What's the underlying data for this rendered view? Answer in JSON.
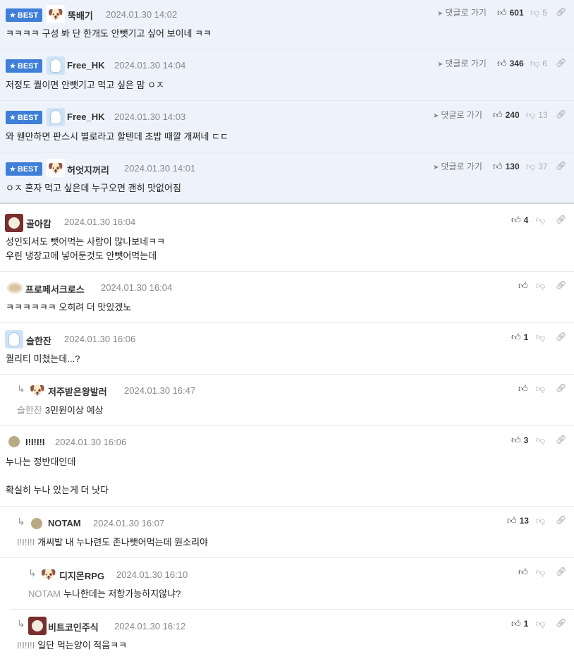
{
  "best_label": "BEST",
  "goto_label": "댓글로 가기",
  "comments": [
    {
      "nick": "뚝배기",
      "date": "2024.01.30 14:02",
      "up": "601",
      "down": "5",
      "text": "ㅋㅋㅋㅋ 구성 봐 단 한개도 안뺏기고 싶어 보이네 ㅋㅋ"
    },
    {
      "nick": "Free_HK",
      "date": "2024.01.30 14:04",
      "up": "346",
      "down": "6",
      "text": "저정도 퀄이면 안뺏기고 먹고 싶은 맘 ㅇㅈ"
    },
    {
      "nick": "Free_HK",
      "date": "2024.01.30 14:03",
      "up": "240",
      "down": "13",
      "text": "와 웬만하면 판스시 별로라고 할텐데 초밥 때깔 개쩌네 ㄷㄷ"
    },
    {
      "nick": "허엇지꺼리",
      "date": "2024.01.30 14:01",
      "up": "130",
      "down": "37",
      "text": "ㅇㅈ 혼자 먹고 싶은데 누구오면 괜히 맛없어짐"
    },
    {
      "nick": "골아캄",
      "date": "2024.01.30 16:04",
      "up": "4",
      "down": "",
      "text": "성인되서도 뺏어먹는 사람이 많나보네ㅋㅋ\n우린 냉장고에 넣어둔것도 안뺏어먹는데"
    },
    {
      "nick": "프로페서크로스",
      "date": "2024.01.30 16:04",
      "up": "",
      "down": "",
      "text": "ㅋㅋㅋㅋㅋㅋ 오히려 더 맛있겠노"
    },
    {
      "nick": "슬한잔",
      "date": "2024.01.30 16:06",
      "up": "1",
      "down": "",
      "text": "퀄리티 미쳤는데...?"
    },
    {
      "nick": "저주받은왕발러",
      "date": "2024.01.30 16:47",
      "up": "",
      "down": "",
      "mention": "슬한잔",
      "text": "3민원이상 예상"
    },
    {
      "nick": "I!I!I!I",
      "date": "2024.01.30 16:06",
      "up": "3",
      "down": "",
      "text": "누나는 정반대인데\n\n확실히 누나 있는게 더 낫다"
    },
    {
      "nick": "NOTAM",
      "date": "2024.01.30 16:07",
      "up": "13",
      "down": "",
      "mention": "I!I!I!I",
      "text": "개씨발 내 누나련도 존나뺏어먹는데 뭔소리야"
    },
    {
      "nick": "디지몬RPG",
      "date": "2024.01.30 16:10",
      "up": "",
      "down": "",
      "mention": "NOTAM",
      "text": "누나한데는 저항가능하지않냐?"
    },
    {
      "nick": "비트코인주식",
      "date": "2024.01.30 16:12",
      "up": "1",
      "down": "",
      "mention": "I!I!I!I",
      "text": "일단 먹는양이 적음ㅋㅋ"
    }
  ],
  "icons": {
    "star": "star-icon",
    "goto": "paper-plane-icon",
    "up": "thumbs-up-icon",
    "down": "thumbs-down-icon",
    "link": "link-icon",
    "reply": "reply-arrow-icon"
  }
}
